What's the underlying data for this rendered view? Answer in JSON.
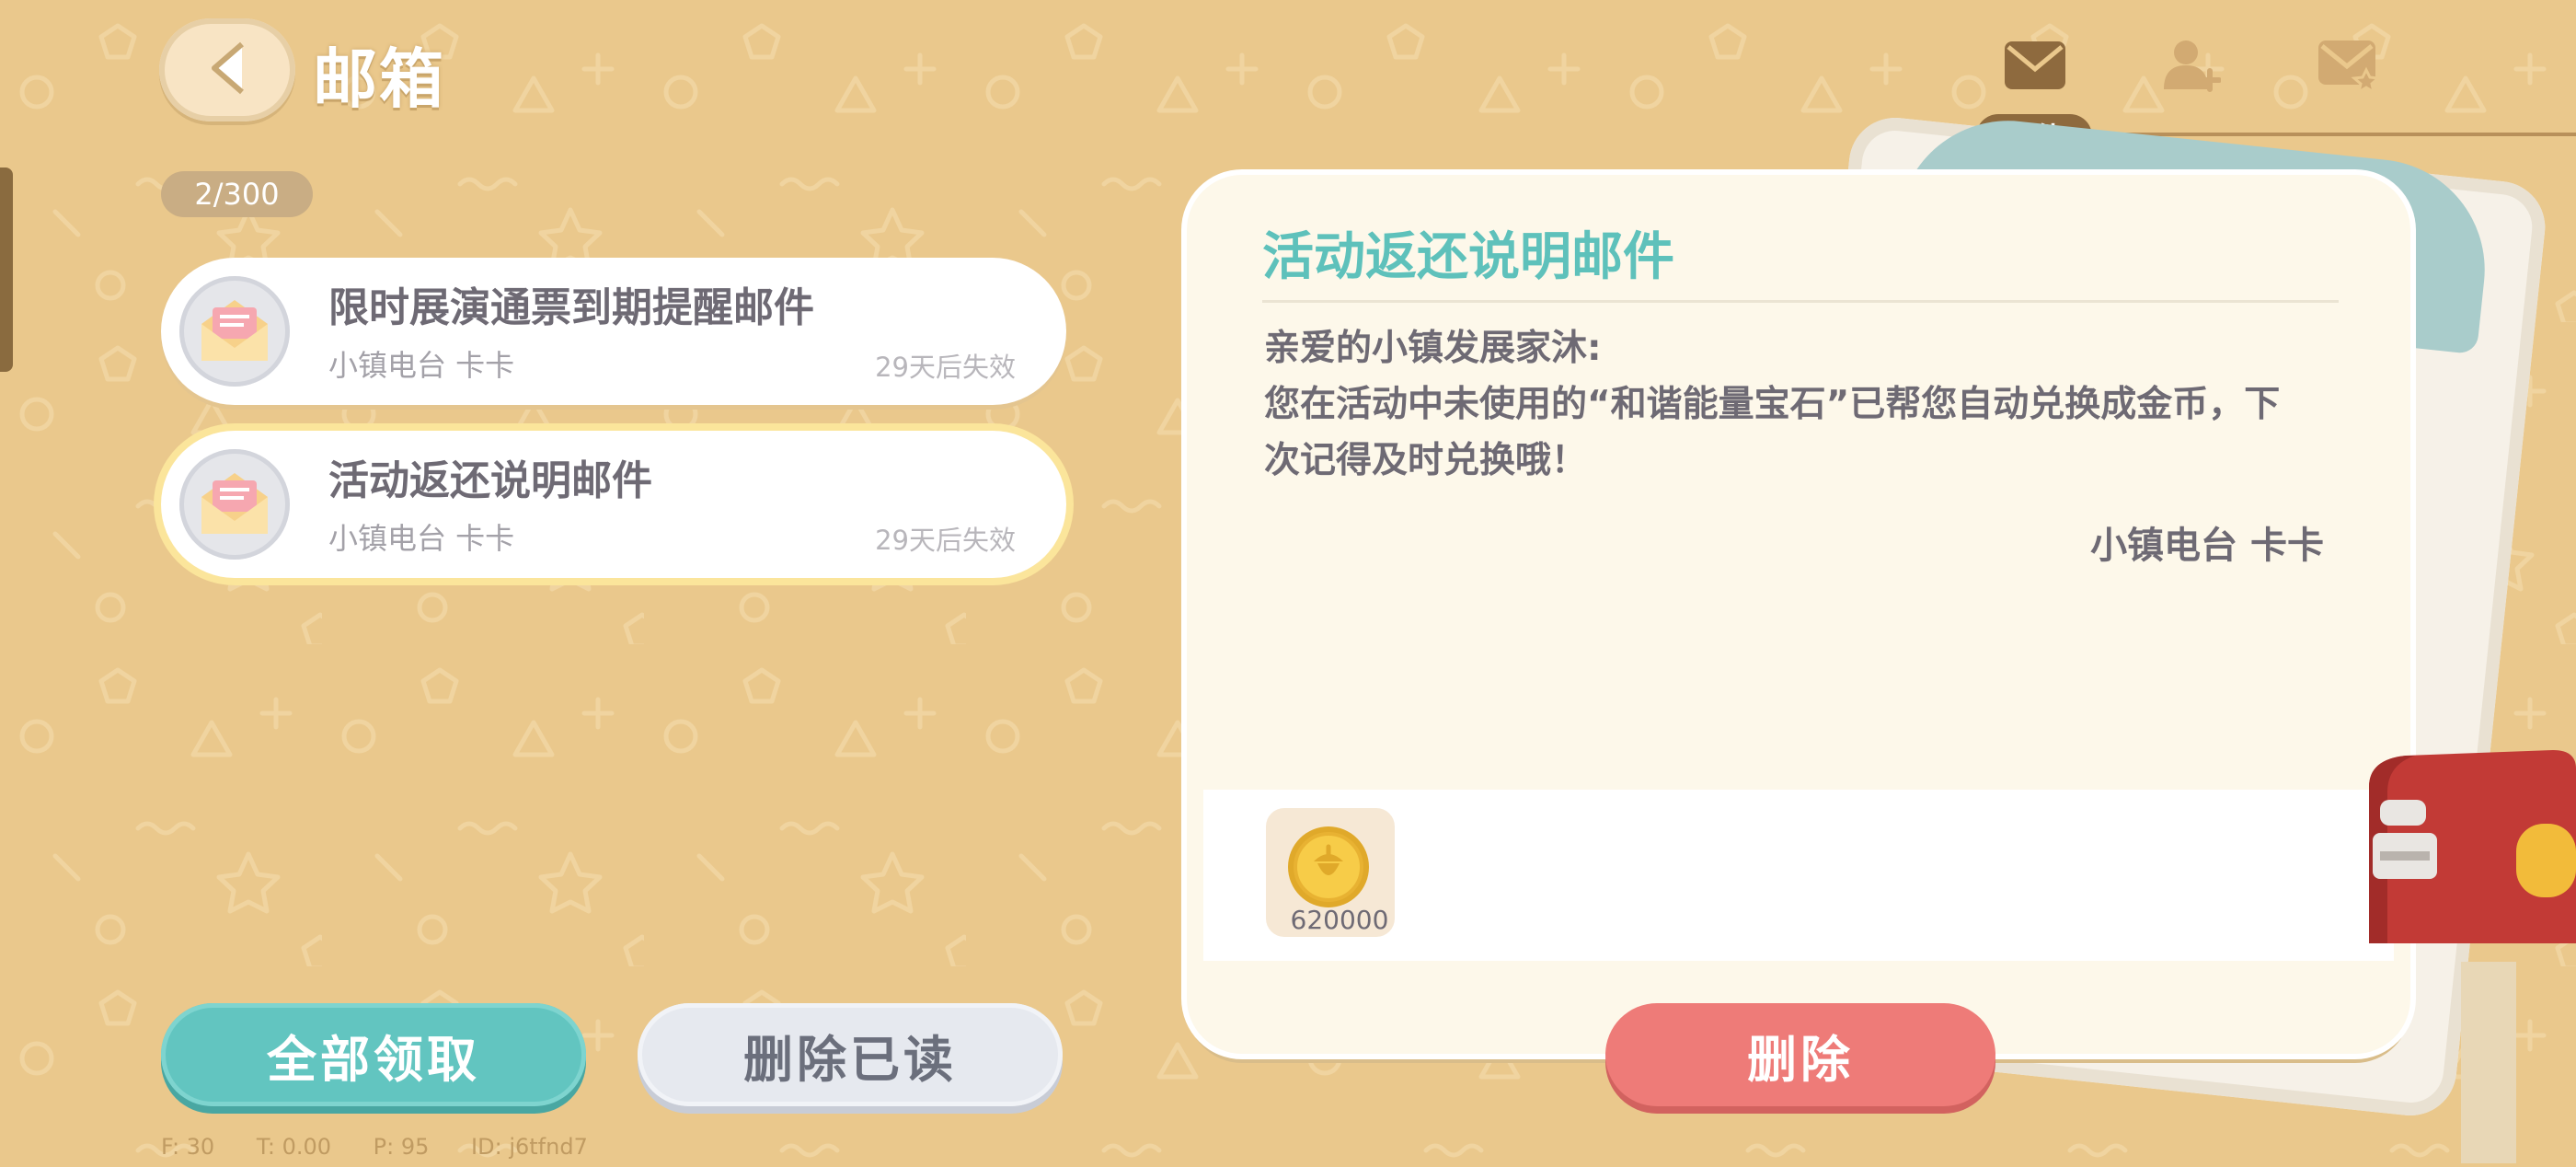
{
  "header": {
    "title": "邮箱",
    "back_icon": "chevron-left-icon"
  },
  "mail_count": "2/300",
  "tabs": [
    {
      "icon": "envelope-icon",
      "label": "邮件",
      "active": true
    },
    {
      "icon": "add-friend-icon",
      "active": false
    },
    {
      "icon": "envelope-star-icon",
      "active": false
    }
  ],
  "mail_list": [
    {
      "title": "限时展演通票到期提醒邮件",
      "sender": "小镇电台 卡卡",
      "expiry": "29天后失效",
      "selected": false
    },
    {
      "title": "活动返还说明邮件",
      "sender": "小镇电台 卡卡",
      "expiry": "29天后失效",
      "selected": true
    }
  ],
  "detail": {
    "title": "活动返还说明邮件",
    "greeting": "亲爱的小镇发展家沐:",
    "body": "您在活动中未使用的“和谐能量宝石”已帮您自动兑换成金币，下次记得及时兑换哦！",
    "signature": "小镇电台 卡卡",
    "attachments": [
      {
        "icon": "gold-coin-icon",
        "quantity": "620000"
      }
    ]
  },
  "buttons": {
    "claim_all": "全部领取",
    "delete_read": "删除已读",
    "delete": "删除"
  },
  "debug": {
    "f": "F: 30",
    "t": "T: 0.00",
    "p": "P: 95",
    "id": "ID: j6tfnd7"
  },
  "colors": {
    "background": "#eac88c",
    "accent_teal": "#62c5c0",
    "delete_red": "#ee7b78",
    "selected_outline": "#fbe59b"
  }
}
